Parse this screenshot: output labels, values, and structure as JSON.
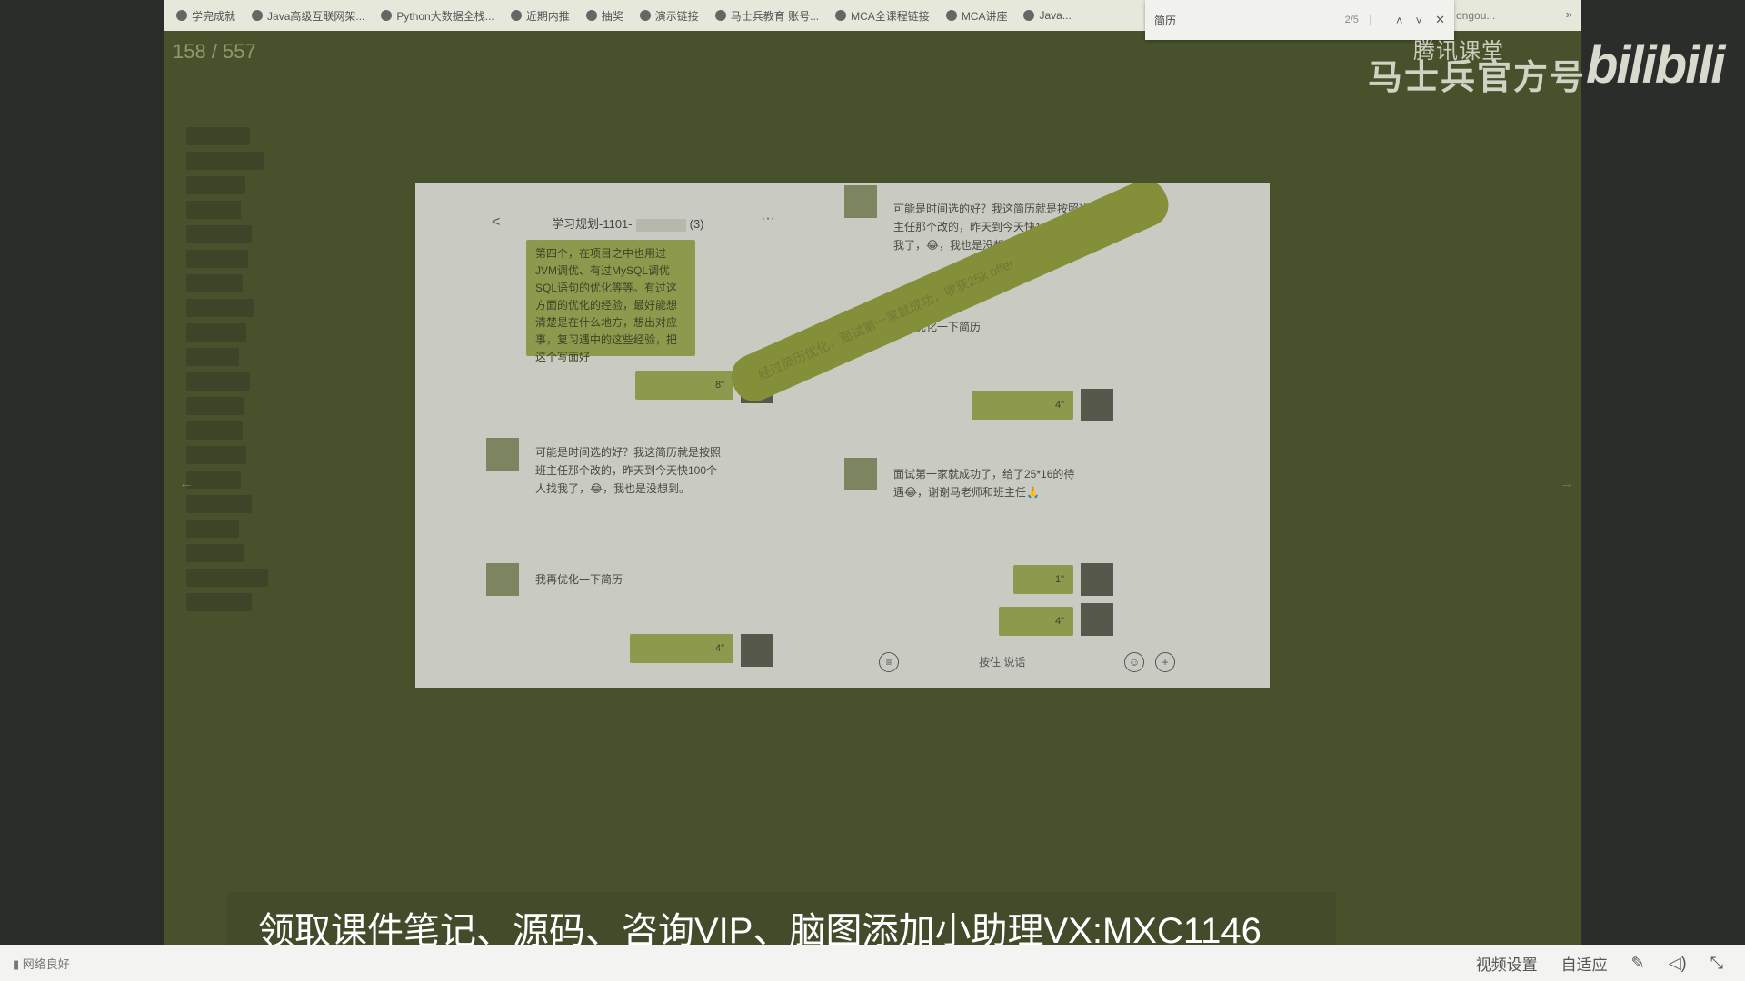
{
  "bookmarks": {
    "items": [
      "学完成就",
      "Java高级互联网架...",
      "Python大数据全栈...",
      "近期内推",
      "抽奖",
      "演示链接",
      "马士兵教育 账号...",
      "MCA全课程链接",
      "MCA讲座",
      "Java..."
    ],
    "overflow_text": "ongou...",
    "more": "»"
  },
  "find": {
    "query": "简历",
    "count": "2/5",
    "up": "˄",
    "down": "˅",
    "close": "✕"
  },
  "page_counter": "158 / 557",
  "watermark": {
    "tencent": "腾讯课堂",
    "brand": "马士兵官方号",
    "bilibili": "bilibili"
  },
  "chat_left": {
    "title": "学习规划-1101-",
    "member_count": "(3)",
    "back": "<",
    "menu": "···",
    "msg1": "第四个，在项目之中也用过JVM调优、有过MySQL调优SQL语句的优化等等。有过这方面的优化的经验，最好能想清楚是在什么地方，想出对应事，复习遇中的这些经验，把这个写面好",
    "voice1": "8\"",
    "msg2": "可能是时间选的好？我这简历就是按照班主任那个改的，昨天到今天快100个人找我了，😂，我也是没想到。",
    "msg3": "我再优化一下简历",
    "voice2": "4\""
  },
  "chat_right": {
    "msg1": "可能是时间选的好？我这简历就是按照班主任那个改的，昨天到今天快100个人找我了，😂，我也是没想到。",
    "msg2": "我再优化一下简历",
    "voice1": "4\"",
    "msg3": "面试第一家就成功了，给了25*16的待遇😂，谢谢马老师和班主任🙏",
    "voice2": "1\"",
    "voice3": "4\"",
    "hold_to_talk": "按住 说话"
  },
  "banner_text": "经过简历优化，面试第一家就成功，收获25k offer",
  "subtitle": "领取课件笔记、源码、咨询VIP、脑图添加小助理VX:MXC1146",
  "controls": {
    "network": "网络良好",
    "video_settings": "视频设置",
    "adaptive": "自适应"
  }
}
